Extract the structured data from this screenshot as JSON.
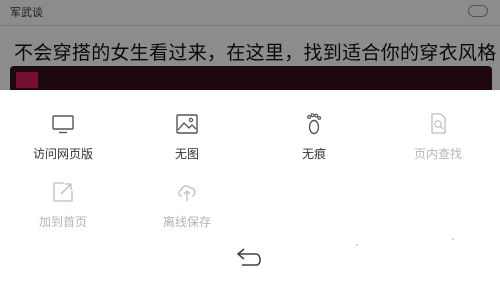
{
  "background_page": {
    "source_label": "军武谈",
    "headline": "不会穿搭的女生看过来，在这里，找到适合你的穿衣风格！"
  },
  "menu": {
    "items": [
      {
        "label": "访问网页版",
        "icon": "monitor-icon",
        "enabled": true
      },
      {
        "label": "无图",
        "icon": "image-icon",
        "enabled": true
      },
      {
        "label": "无痕",
        "icon": "footprint-icon",
        "enabled": true
      },
      {
        "label": "页内查找",
        "icon": "find-in-page-icon",
        "enabled": false
      },
      {
        "label": "加到首页",
        "icon": "add-to-home-icon",
        "enabled": false
      },
      {
        "label": "离线保存",
        "icon": "cloud-save-icon",
        "enabled": false
      }
    ],
    "back_icon": "back-arrow-icon"
  },
  "colors": {
    "overlay": "#000000",
    "enabled_text": "#333333",
    "disabled_text": "#b5b5b5",
    "headline_banner": "#3a0f1c",
    "badge": "#d81b60"
  }
}
